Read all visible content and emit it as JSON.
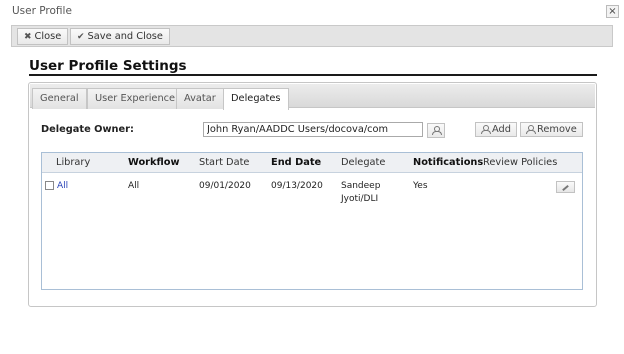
{
  "window": {
    "title": "User Profile",
    "close_glyph": "×"
  },
  "toolbar": {
    "close_label": "Close",
    "save_close_label": "Save and Close"
  },
  "settings": {
    "title": "User Profile Settings"
  },
  "tabs": [
    {
      "label": "General"
    },
    {
      "label": "User Experience"
    },
    {
      "label": "Avatar"
    },
    {
      "label": "Delegates",
      "active": true
    }
  ],
  "delegate_owner": {
    "label": "Delegate Owner:",
    "value": "John Ryan/AADDC Users/docova/com",
    "add_label": "Add",
    "remove_label": "Remove"
  },
  "grid": {
    "columns": [
      {
        "label": "Library",
        "bold": false
      },
      {
        "label": "Workflow",
        "bold": true
      },
      {
        "label": "Start Date",
        "bold": false
      },
      {
        "label": "End Date",
        "bold": true
      },
      {
        "label": "Delegate",
        "bold": false
      },
      {
        "label": "Notifications",
        "bold": true
      },
      {
        "label": "Review Policies",
        "bold": false
      }
    ],
    "rows": [
      {
        "checked": false,
        "library": "All",
        "workflow": "All",
        "start_date": "09/01/2020",
        "end_date": "09/13/2020",
        "delegate_line1": "Sandeep",
        "delegate_line2": "Jyoti/DLI",
        "notifications": "Yes",
        "review_policies": ""
      }
    ]
  },
  "colors": {
    "link": "#2a44b8",
    "grid_border": "#a9bfd6",
    "toolbar_bg": "#e4e4e4"
  }
}
